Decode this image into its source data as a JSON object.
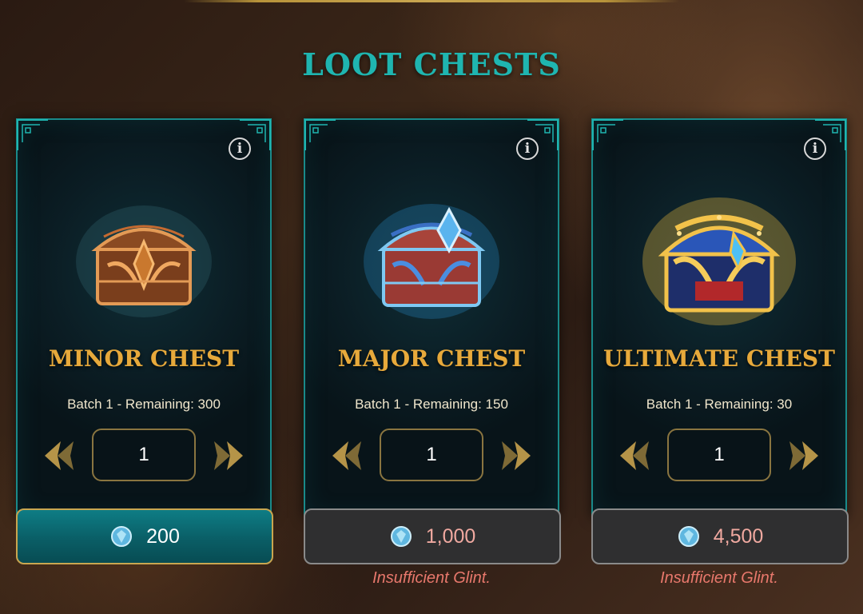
{
  "page": {
    "title": "LOOT CHESTS"
  },
  "chests": [
    {
      "name": "MINOR CHEST",
      "batch_info": "Batch 1 - Remaining: 300",
      "quantity": "1",
      "price": "200",
      "warning": "",
      "tier": "minor",
      "button_state": "active"
    },
    {
      "name": "MAJOR CHEST",
      "batch_info": "Batch 1 - Remaining: 150",
      "quantity": "1",
      "price": "1,000",
      "warning": "Insufficient Glint.",
      "tier": "major",
      "button_state": "disabled"
    },
    {
      "name": "ULTIMATE CHEST",
      "batch_info": "Batch 1 - Remaining: 30",
      "quantity": "1",
      "price": "4,500",
      "warning": "Insufficient Glint.",
      "tier": "ultimate",
      "button_state": "disabled"
    }
  ],
  "icons": {
    "info": "info-icon",
    "decrease": "chevron-left-icon",
    "increase": "chevron-right-icon",
    "currency": "glint-gem-icon"
  },
  "colors": {
    "title": "#1fb5b0",
    "chest_name": "#e7a93b",
    "card_border": "#1a8a8a",
    "active_button": "#0a5e66",
    "warning_text": "#e8786c",
    "disabled_price": "#f0a9a0"
  }
}
